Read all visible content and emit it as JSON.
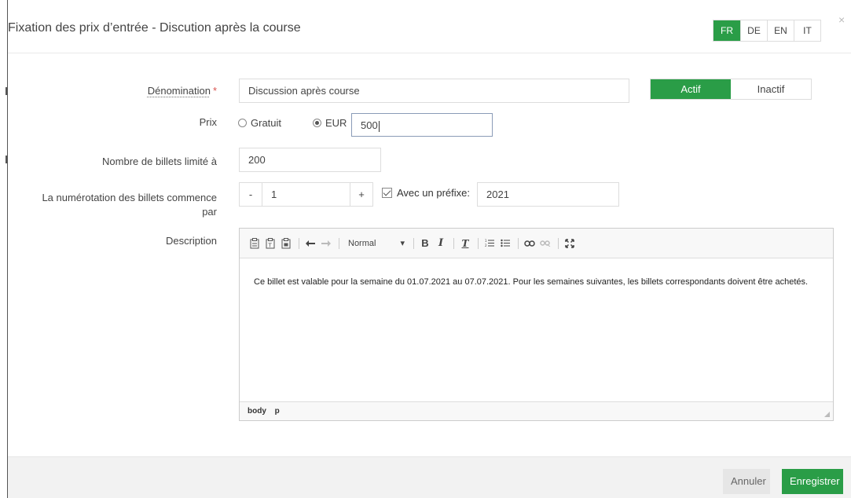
{
  "header": {
    "title": "Fixation des prix d’entrée - Discution après la course",
    "languages": [
      "FR",
      "DE",
      "EN",
      "IT"
    ],
    "active_language": "FR",
    "close_icon": "×"
  },
  "form": {
    "name": {
      "label": "Dénomination",
      "required_mark": "*",
      "value": "Discussion après course"
    },
    "status": {
      "options": [
        "Actif",
        "Inactif"
      ],
      "selected": "Actif"
    },
    "price": {
      "label": "Prix",
      "option_free": "Gratuit",
      "option_currency": "EUR",
      "selected": "EUR",
      "value": "500"
    },
    "ticket_limit": {
      "label": "Nombre de billets limité à",
      "value": "200"
    },
    "numbering": {
      "label": "La numérotation des billets commence par",
      "minus": "-",
      "plus": "+",
      "value": "1",
      "prefix_checked": true,
      "prefix_label": "Avec un préfixe:",
      "prefix_value": "2021"
    },
    "description": {
      "label": "Description",
      "format": "Normal",
      "text": "Ce billet est valable pour la semaine du 01.07.2021 au 07.07.2021. Pour les semaines suivantes, les billets correspondants doivent être achetés.",
      "path": [
        "body",
        "p"
      ]
    }
  },
  "footer": {
    "cancel_label": "Annuler",
    "save_label": "Enregistrer"
  },
  "colors": {
    "accent": "#2a9d47",
    "required": "#d9534f"
  }
}
